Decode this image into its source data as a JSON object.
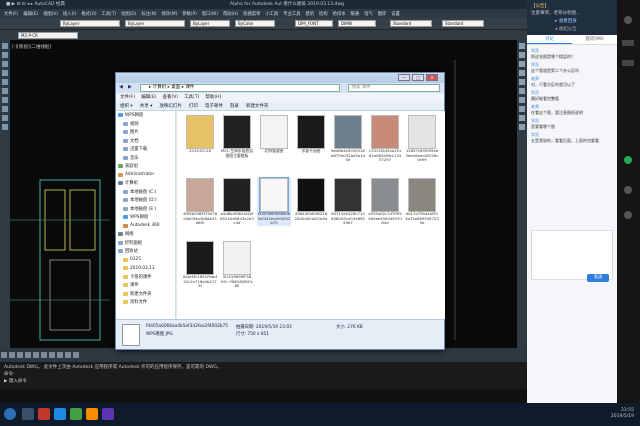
{
  "cad": {
    "title_left": "■ ▶ ⊟ ⊡ ◂ ▸ AutoCAD 经典",
    "title_center": "Alpha for Autodesk Aut   看什么图纸  2019.03.13.dwg",
    "menu": [
      "文件(F)",
      "编辑(E)",
      "视图(V)",
      "插入(I)",
      "格式(O)",
      "工具(T)",
      "绘图(D)",
      "标注(N)",
      "修改(M)",
      "参数(P)",
      "窗口(W)",
      "帮助(H)",
      "快捷菜单",
      "小工具",
      "专业工具",
      "建筑",
      "结构",
      "给排水",
      "暖通",
      "电气",
      "图库",
      "设置"
    ],
    "layer_combo": "M2-P-CR",
    "color_combo": "ByLayer",
    "linetype_combo": "ByLayer",
    "lineweight_combo": "ByLayer",
    "color2_combo": "ByColor",
    "textstyle_combo": "DIM_FONT",
    "dimstyle_combo": "DIMN",
    "tablestyle_combo": "Standard",
    "mleader_combo": "Standard",
    "view_label": "[-][俯视][二维线框]",
    "cmd_lines": [
      "Autodesk DWG。 此文件上次由 Autodesk 应用程序或 Autodesk 许可的应用程序保存，是可靠的 DWG。",
      "命令:",
      "▶ 键入命令"
    ]
  },
  "explorer": {
    "address": "▸ 计算机 ▸ 桌面 ▸ 课件",
    "search_placeholder": "搜索 课件",
    "menu": [
      "文件(F)",
      "编辑(E)",
      "查看(V)",
      "工具(T)",
      "帮助(H)"
    ],
    "commands": [
      "组织 ▾",
      "共享 ▾",
      "放映幻灯片",
      "打印",
      "电子邮件",
      "刻录",
      "新建文件夹"
    ],
    "nav": [
      {
        "label": "WPS网盘",
        "color": "#4f9be6"
      },
      {
        "label": "视频",
        "color": "#8aa5c8"
      },
      {
        "label": "图片",
        "color": "#8aa5c8"
      },
      {
        "label": "文档",
        "color": "#8aa5c8"
      },
      {
        "label": "迅雷下载",
        "color": "#8aa5c8"
      },
      {
        "label": "音乐",
        "color": "#8aa5c8"
      },
      {
        "label": "家庭组",
        "color": "#5ea75e"
      },
      {
        "label": "Administrator",
        "color": "#c89c52"
      },
      {
        "label": "计算机",
        "color": "#6d7f93"
      },
      {
        "label": "本地磁盘 (C:)",
        "color": "#8aa5c8"
      },
      {
        "label": "本地磁盘 (D:)",
        "color": "#8aa5c8"
      },
      {
        "label": "本地磁盘 (E:)",
        "color": "#8aa5c8"
      },
      {
        "label": "WPS网盘",
        "color": "#4f9be6"
      },
      {
        "label": "Autodesk 360",
        "color": "#cc8844"
      },
      {
        "label": "网络",
        "color": "#6d7f93"
      },
      {
        "label": "控制面板",
        "color": "#8aa5c8"
      },
      {
        "label": "回收站",
        "color": "#8aa5c8"
      },
      {
        "label": "0325",
        "color": "#e5c45a"
      },
      {
        "label": "2019.03.13",
        "color": "#e5c45a"
      },
      {
        "label": "卡筏的课件",
        "color": "#e5c45a"
      },
      {
        "label": "课件",
        "color": "#e5c45a"
      },
      {
        "label": "新建文件夹",
        "color": "#e5c45a"
      },
      {
        "label": "资料文件",
        "color": "#e5c45a"
      }
    ],
    "files": [
      {
        "name": "2019.05.28",
        "thumb": "#e7c166"
      },
      {
        "name": "M01-空调水管底层图纸主要楼板",
        "thumb": "#222"
      },
      {
        "name": "北侧管道图",
        "thumb": "#f3f3f3"
      },
      {
        "name": "水管平面图",
        "thumb": "#1a1a1a"
      },
      {
        "name": "8ee8b4e0050316b87f4e2f2ae5b1d5e",
        "thumb": "#6c7f8c"
      },
      {
        "name": "13315f2d34a15162a060a5fec13457297",
        "thumb": "#c88b7a"
      },
      {
        "name": "12857c8f3009ea3ee0dbecd0226c0e99",
        "thumb": "#e4e4e4"
      },
      {
        "name": "4f99b2989f75e78c6b03da3b6db33d8f0",
        "thumb": "#c7a79a"
      },
      {
        "name": "b4d6b4f9b34f40f85244d5843e2b3c4d",
        "thumb": "#222"
      },
      {
        "name": "f4405a6066aa4b5ef342fea2f4002b75",
        "thumb": "#f7f7f7"
      },
      {
        "name": "49640f5d0f0D1b2840d92d2f1b5a",
        "thumb": "#111"
      },
      {
        "name": "85315e0426c7138080091e03e89559d7",
        "thumb": "#333"
      },
      {
        "name": "a535a02c7d7f5f50d4ee50e0d097084d",
        "thumb": "#8a8d8f"
      },
      {
        "name": "de17a795a4af514b72a6895567235b",
        "thumb": "#8b8680"
      },
      {
        "name": "fb4e5fc1691f9abf22c2e726a0b2175f",
        "thumb": "#1a1a1a"
      },
      {
        "name": "5U1Q9699IF58K%~NMG6IJ9D%6E",
        "thumb": "#f2f2f2"
      }
    ],
    "details": {
      "name": "f4405a6066aa4b5ef342fea2f4002b75",
      "type": "WPS看图 JPG",
      "taken": "拍摄日期: 2019/5/19 23:03",
      "size": "大小: 276 KB",
      "dims": "尺寸: 750 x 851"
    }
  },
  "chat": {
    "header_title": "【公告】",
    "header_sub": "注意事项，老师分析图...",
    "header_btn": "▸ 收看回放",
    "header_more": "◂ 收起公告",
    "tab_chat": "讨论",
    "tab_qa": "提问(99)",
    "messages": [
      {
        "who": "学员",
        "text": "那这张图是哪个楼层的？"
      },
      {
        "who": "学员",
        "text": "这个管道是第二个办公区吗"
      },
      {
        "who": "老师",
        "text": "对，只看分区的就可以了"
      },
      {
        "who": "学员",
        "text": "最好能看完整版"
      },
      {
        "who": "老师",
        "text": "在看这个图，要注意图纸说明"
      },
      {
        "who": "学员",
        "text": "是要看哪个图"
      },
      {
        "who": "学员",
        "text": "五是我说的，看看后面，上面的也要看"
      }
    ],
    "send": "发送"
  },
  "taskbar": {
    "time": "23:55",
    "date": "2019/5/19"
  }
}
